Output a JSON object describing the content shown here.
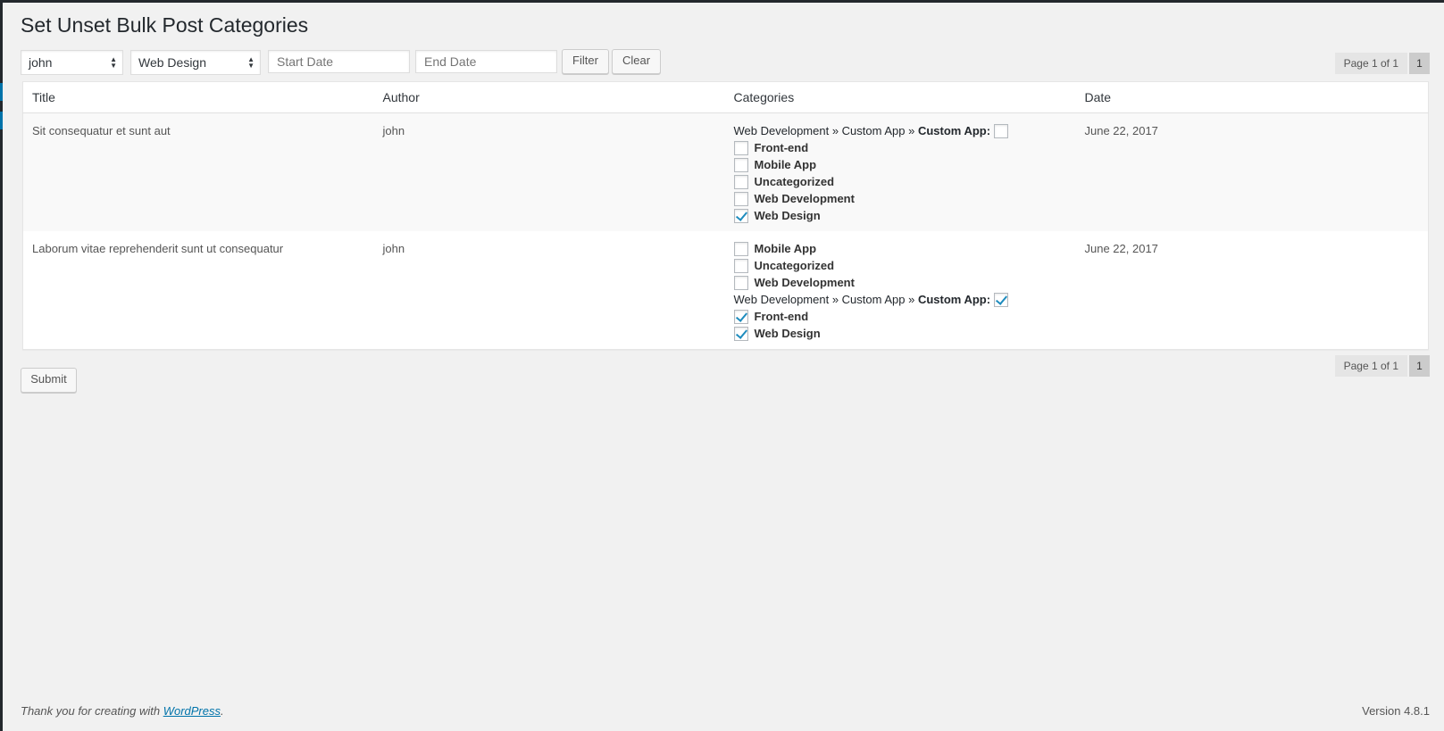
{
  "page": {
    "title": "Set Unset Bulk Post Categories"
  },
  "filters": {
    "author_selected": "john",
    "category_selected": "Web Design",
    "start_date_placeholder": "Start Date",
    "end_date_placeholder": "End Date",
    "filter_label": "Filter",
    "clear_label": "Clear"
  },
  "pagination": {
    "info": "Page 1 of 1",
    "current": "1"
  },
  "table": {
    "headers": [
      "Title",
      "Author",
      "Categories",
      "Date"
    ],
    "rows": [
      {
        "title": "Sit consequatur et sunt aut",
        "author": "john",
        "date": "June 22, 2017",
        "path_prefix": "Web Development » Custom App » ",
        "path_bold": "Custom App:",
        "path_checked": false,
        "path_position": "first",
        "categories": [
          {
            "label": "Front-end",
            "checked": false
          },
          {
            "label": "Mobile App",
            "checked": false
          },
          {
            "label": "Uncategorized",
            "checked": false
          },
          {
            "label": "Web Development",
            "checked": false
          },
          {
            "label": "Web Design",
            "checked": true
          }
        ]
      },
      {
        "title": "Laborum vitae reprehenderit sunt ut consequatur",
        "author": "john",
        "date": "June 22, 2017",
        "path_prefix": "Web Development » Custom App » ",
        "path_bold": "Custom App:",
        "path_checked": true,
        "categories_before": [
          {
            "label": "Mobile App",
            "checked": false
          },
          {
            "label": "Uncategorized",
            "checked": false
          },
          {
            "label": "Web Development",
            "checked": false
          }
        ],
        "categories_after": [
          {
            "label": "Front-end",
            "checked": true
          },
          {
            "label": "Web Design",
            "checked": true
          }
        ]
      }
    ]
  },
  "actions": {
    "submit_label": "Submit"
  },
  "footer": {
    "thanks_prefix": "Thank you for creating with ",
    "link_text": "WordPress",
    "thanks_suffix": ".",
    "version": "Version 4.8.1"
  },
  "colors": {
    "background": "#f1f1f1",
    "admin_bar": "#23282d",
    "accent": "#0073aa",
    "check": "#1e8cbe"
  }
}
